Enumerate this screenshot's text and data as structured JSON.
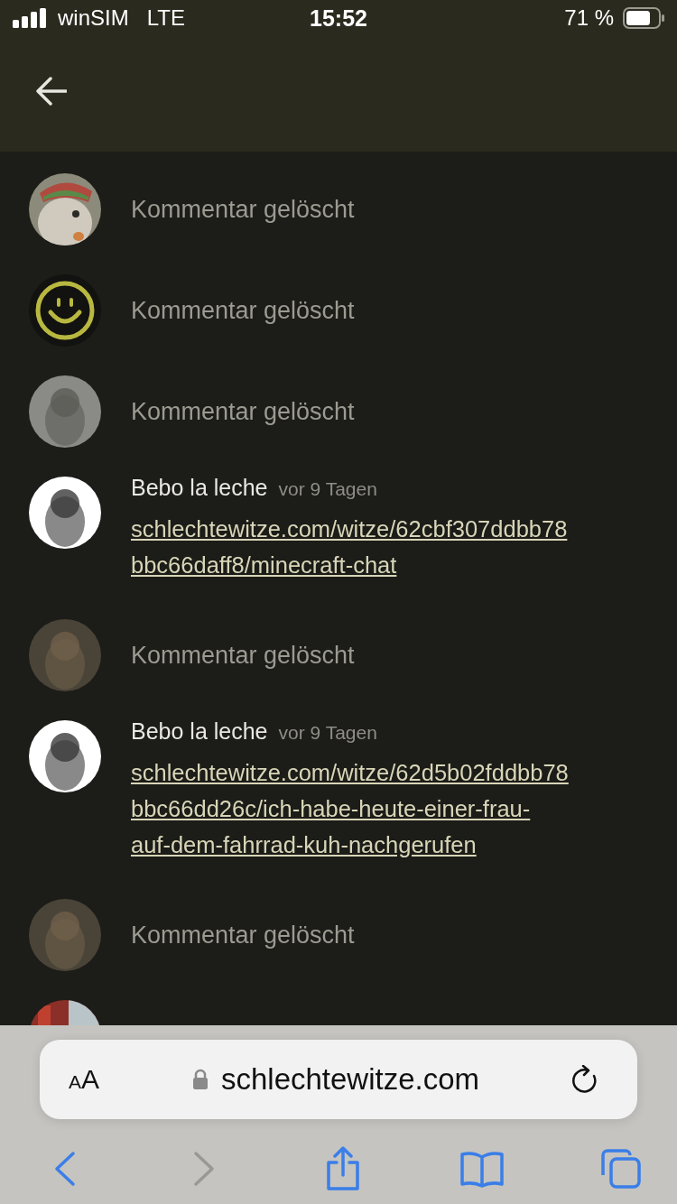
{
  "status_bar": {
    "carrier": "winSIM",
    "network": "LTE",
    "time": "15:52",
    "battery": "71 %"
  },
  "comments": [
    {
      "kind": "deleted",
      "text": "Kommentar gelöscht"
    },
    {
      "kind": "deleted",
      "avatar": {
        "kind": "smiley"
      },
      "text": "Kommentar gelöscht"
    },
    {
      "kind": "deleted",
      "avatar": {
        "kind": "grey"
      },
      "text": "Kommentar gelöscht"
    },
    {
      "kind": "comment",
      "avatar": {
        "kind": "white"
      },
      "author": "Bebo la leche",
      "time": "vor 9 Tagen",
      "link_lines": [
        "schlechtewitze.com/witze/62cbf307ddbb78",
        "bbc66daff8/minecraft-chat"
      ]
    },
    {
      "kind": "deleted",
      "avatar": {
        "kind": "brown"
      },
      "text": "Kommentar gelöscht"
    },
    {
      "kind": "comment",
      "avatar": {
        "kind": "white"
      },
      "author": "Bebo la leche",
      "time": "vor 9 Tagen",
      "link_lines": [
        "schlechtewitze.com/witze/62d5b02fddbb78",
        "bbc66dd26c/ich-habe-heute-einer-frau-",
        "auf-dem-fahrrad-kuh-nachgerufen"
      ]
    },
    {
      "kind": "deleted",
      "avatar": {
        "kind": "brown"
      },
      "text": "Kommentar gelöscht"
    },
    {
      "kind": "hidden",
      "avatar": {
        "kind": "red"
      }
    }
  ],
  "browser": {
    "text_size": "AA",
    "url": "schlechtewitze.com",
    "nav": [
      {
        "kind": "back",
        "disabled": false
      },
      {
        "kind": "forward",
        "disabled": true
      },
      {
        "kind": "share",
        "disabled": false
      },
      {
        "kind": "bookmarks",
        "disabled": false
      },
      {
        "kind": "tabs",
        "disabled": false
      }
    ]
  }
}
